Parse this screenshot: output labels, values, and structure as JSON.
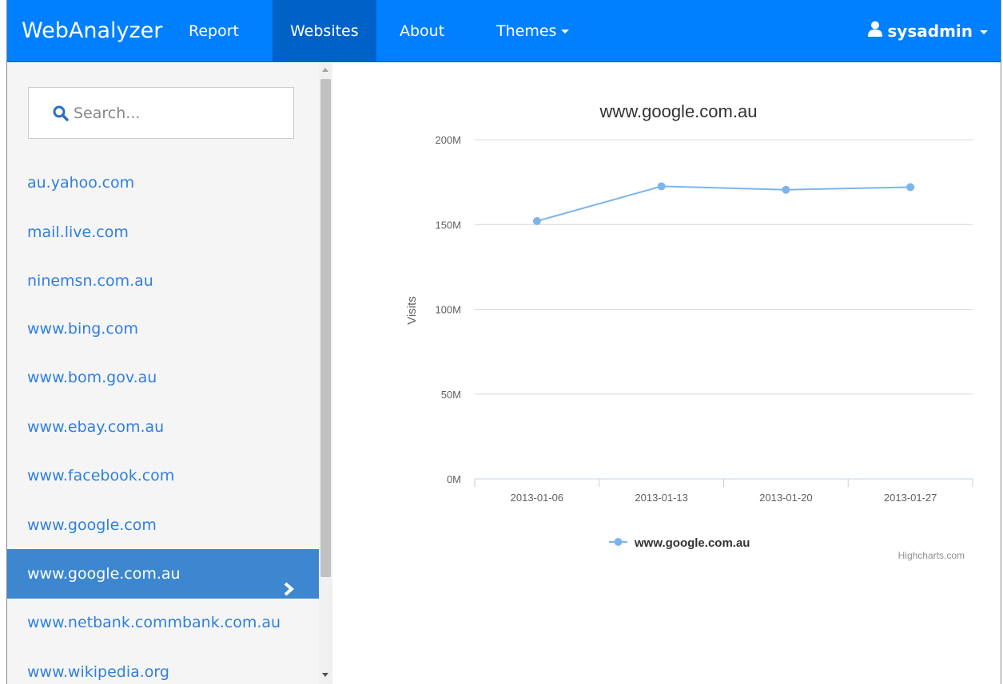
{
  "navbar": {
    "brand": "WebAnalyzer",
    "items": [
      {
        "label": "Report"
      },
      {
        "label": "Websites"
      },
      {
        "label": "About"
      },
      {
        "label": "Themes"
      }
    ],
    "user": "sysadmin"
  },
  "sidebar": {
    "search_placeholder": "Search...",
    "items": [
      {
        "label": "au.yahoo.com"
      },
      {
        "label": "mail.live.com"
      },
      {
        "label": "ninemsn.com.au"
      },
      {
        "label": "www.bing.com"
      },
      {
        "label": "www.bom.gov.au"
      },
      {
        "label": "www.ebay.com.au"
      },
      {
        "label": "www.facebook.com"
      },
      {
        "label": "www.google.com"
      },
      {
        "label": "www.google.com.au"
      },
      {
        "label": "www.netbank.commbank.com.au"
      },
      {
        "label": "www.wikipedia.org"
      }
    ],
    "selected_index": 8
  },
  "colors": {
    "navbar": "#007fff",
    "nav_active": "#0061c7",
    "link": "#2f7fe0",
    "selected": "#3c87cf",
    "series": "#7cb5ec"
  },
  "chart_data": {
    "type": "line",
    "title": "www.google.com.au",
    "ylabel": "Visits",
    "xlabel": "",
    "categories": [
      "2013-01-06",
      "2013-01-13",
      "2013-01-20",
      "2013-01-27"
    ],
    "series": [
      {
        "name": "www.google.com.au",
        "values": [
          152,
          172.5,
          170.5,
          172
        ]
      }
    ],
    "yunit_suffix": "M",
    "ylim": [
      0,
      200
    ],
    "yticks": [
      0,
      50,
      100,
      150,
      200
    ],
    "ytick_labels": [
      "0M",
      "50M",
      "100M",
      "150M",
      "200M"
    ],
    "grid": true,
    "legend_position": "bottom",
    "credits": "Highcharts.com"
  }
}
